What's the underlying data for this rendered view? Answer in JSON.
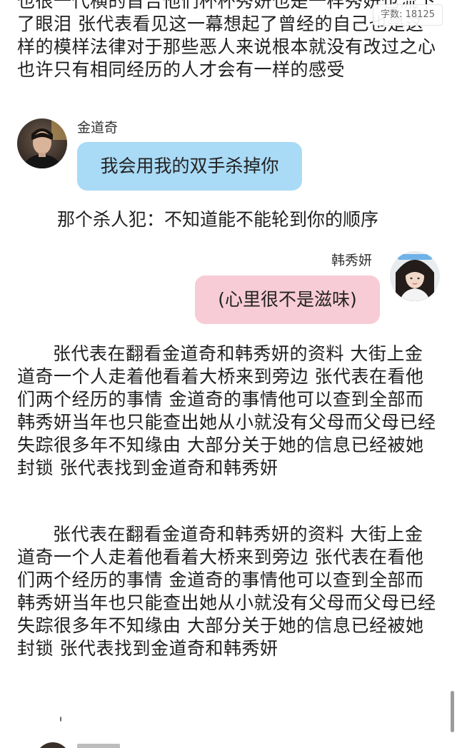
{
  "word_count": {
    "label": "字数: 18125"
  },
  "top_paragraph": {
    "text": "也很一代横的首告他们杯杯秀妍也是一样秀妍也流下了眼泪 张代表看见这一幕想起了曾经的自己也是这样的模样法律对于那些恶人来说根本就没有改过之心也许只有相同经历的人才会有一样的感受"
  },
  "chat": {
    "left_speaker": {
      "name": "金道奇",
      "avatar_icon": "male-portrait-avatar",
      "message": "我会用我的双手杀掉你",
      "bubble_color": "#a9daf6"
    },
    "narration": "那个杀人犯：不知道能不能轮到你的顺序",
    "right_speaker": {
      "name": "韩秀妍",
      "avatar_icon": "female-portrait-avatar",
      "message": "(心里很不是滋味)",
      "bubble_color": "#f7ccd6"
    }
  },
  "paragraphs": [
    "张代表在翻看金道奇和韩秀妍的资料 大街上金道奇一个人走着他看着大桥来到旁边 张代表在看他们两个经历的事情 金道奇的事情他可以查到全部而韩秀妍当年也只能查出她从小就没有父母而父母已经失踪很多年不知缘由 大部分关于她的信息已经被她封锁 张代表找到金道奇和韩秀妍",
    "张代表在翻看金道奇和韩秀妍的资料 大街上金道奇一个人走着他看着大桥来到旁边 张代表在看他们两个经历的事情 金道奇的事情他可以查到全部而韩秀妍当年也只能查出她从小就没有父母而父母已经失踪很多年不知缘由 大部分关于她的信息已经被她封锁 张代表找到金道奇和韩秀妍"
  ],
  "cursor_mark": "ˌ"
}
